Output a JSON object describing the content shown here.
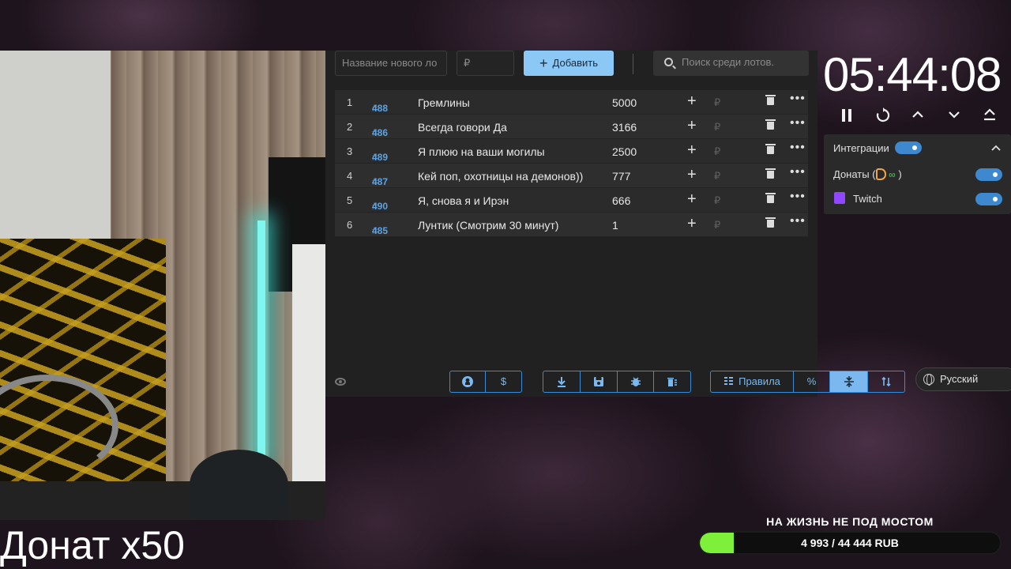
{
  "webcam_caption": "Донат x50",
  "add_form": {
    "name_placeholder": "Название нового ло",
    "amount_placeholder": "₽",
    "add_label": "Добавить"
  },
  "search": {
    "placeholder": "Поиск среди лотов."
  },
  "lots": [
    {
      "index": "1",
      "lot_id": "488",
      "name": "Гремлины",
      "amount": "5000"
    },
    {
      "index": "2",
      "lot_id": "486",
      "name": "Всегда говори Да",
      "amount": "3166"
    },
    {
      "index": "3",
      "lot_id": "489",
      "name": "Я плюю на ваши могилы",
      "amount": "2500"
    },
    {
      "index": "4",
      "lot_id": "487",
      "name": "Кей поп, охотницы на демонов))",
      "amount": "777"
    },
    {
      "index": "5",
      "lot_id": "490",
      "name": "Я, снова я и Ирэн",
      "amount": "666"
    },
    {
      "index": "6",
      "lot_id": "485",
      "name": "Лунтик (Смотрим 30 минут)",
      "amount": "1"
    }
  ],
  "currency_symbol": "₽",
  "toolbar": {
    "rules_label": "Правила",
    "percent_label": "%",
    "dollar_label": "$",
    "language": "Русский"
  },
  "timer": {
    "value": "05:44:08"
  },
  "integrations": {
    "title": "Интеграции",
    "donations_label": "Донаты (",
    "donations_suffix": ")",
    "infinity": "∞",
    "twitch_label": "Twitch",
    "enabled": true
  },
  "goal": {
    "title": "НА ЖИЗНЬ НЕ ПОД МОСТОМ",
    "progress_text": "4 993 / 44 444 RUB",
    "current": 4993,
    "target": 44444
  },
  "colors": {
    "accent": "#7ab8ef",
    "toggle": "#3d88cf",
    "lot_id": "#5aa3e6",
    "goal_fill": "#7ff03a",
    "twitch": "#9146ff",
    "donationalerts": "#f0a44a"
  },
  "icons": {
    "github": "github-icon",
    "download": "download-icon",
    "save": "save-icon",
    "bug": "bug-icon",
    "clear": "clear-list-icon",
    "sort": "sort-icon",
    "merge": "compress-icon"
  }
}
